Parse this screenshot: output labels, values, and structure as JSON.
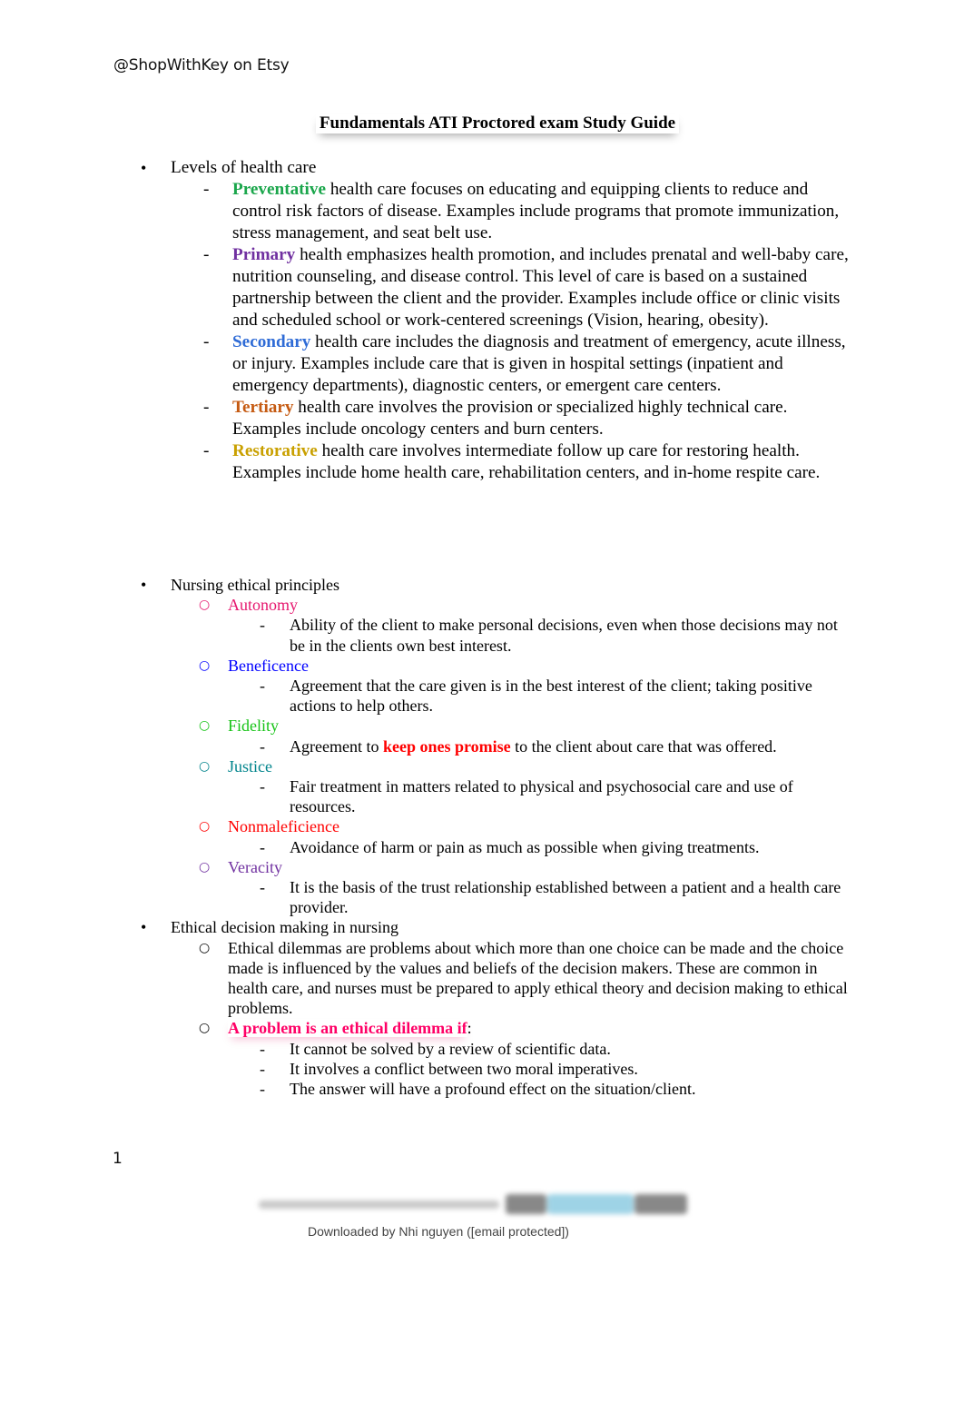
{
  "header_note": "@ShopWithKey on Etsy",
  "title": "Fundamentals ATI Proctored exam Study Guide",
  "colors": {
    "preventative": "#1aa64b",
    "primary": "#7030a0",
    "secondary": "#2e6bd6",
    "tertiary": "#c55a11",
    "restorative": "#c9a000",
    "autonomy": "#e6176e",
    "beneficence": "#0000ff",
    "fidelity": "#16c316",
    "justice": "#00848c",
    "nonmaleficience": "#ff0000",
    "veracity": "#7030a0",
    "highlight_red": "#ff0000",
    "dilemma_pink": "#ff0066"
  },
  "sections": {
    "levels": {
      "heading": "Levels of health care",
      "items": [
        {
          "term": "Preventative",
          "text": " health care focuses on educating and equipping clients to reduce and control risk factors of disease. Examples include programs that promote immunization, stress management, and seat belt use."
        },
        {
          "term": "Primary",
          "text": " health emphasizes health promotion, and includes prenatal and well-baby care, nutrition counseling, and disease control. This level of care is based on a sustained partnership between the client and the provider. Examples include office or clinic visits and scheduled school or work-centered screenings (Vision, hearing, obesity)."
        },
        {
          "term": "Secondary",
          "text": " health care includes the diagnosis and treatment of emergency, acute illness, or injury. Examples include care that is given in hospital settings (inpatient and emergency departments), diagnostic centers, or emergent care centers."
        },
        {
          "term": "Tertiary",
          "text": " health care involves the provision or specialized highly technical care. Examples include oncology centers and burn centers."
        },
        {
          "term": "Restorative",
          "text": " health care involves intermediate follow up care for restoring health. Examples include home health care, rehabilitation centers, and in-home respite care."
        }
      ]
    },
    "principles": {
      "heading": "Nursing ethical principles",
      "items": [
        {
          "term": "Autonomy",
          "desc": "Ability of the client to make personal decisions, even when those decisions may not be in the clients own best interest."
        },
        {
          "term": "Beneficence",
          "desc": "Agreement that the care given is in the best interest of the client; taking positive actions to help others."
        },
        {
          "term": "Fidelity",
          "desc_before": "Agreement to ",
          "desc_highlight": "keep ones promise",
          "desc_after": " to the client about care that was offered."
        },
        {
          "term": "Justice",
          "desc": "Fair treatment in matters related to physical and psychosocial care and use of resources."
        },
        {
          "term": "Nonmaleficience",
          "desc": "Avoidance of harm or pain as much as possible when giving treatments."
        },
        {
          "term": "Veracity",
          "desc": "It is the basis of the trust relationship established between a patient and a health care provider."
        }
      ]
    },
    "decision": {
      "heading": "Ethical decision making in nursing",
      "paragraph": "Ethical dilemmas are problems about which more than one choice can be made and the choice made is influenced by the values and beliefs of the decision makers. These are common in health care, and nurses must be prepared to apply ethical theory and decision making to ethical problems.",
      "dilemma_label": "A problem is an ethical dilemma if",
      "dilemma_colon": ":",
      "criteria": [
        "It cannot be solved by a review of scientific data.",
        "It involves a conflict between two moral imperatives.",
        "The answer will have a profound effect on the situation/client."
      ]
    }
  },
  "symbols": {
    "bullet": "•",
    "dash": "-",
    "circle": "○"
  },
  "page_number": "1",
  "footer": {
    "downloaded_by": "Downloaded by Nhi nguyen ([email protected])"
  }
}
